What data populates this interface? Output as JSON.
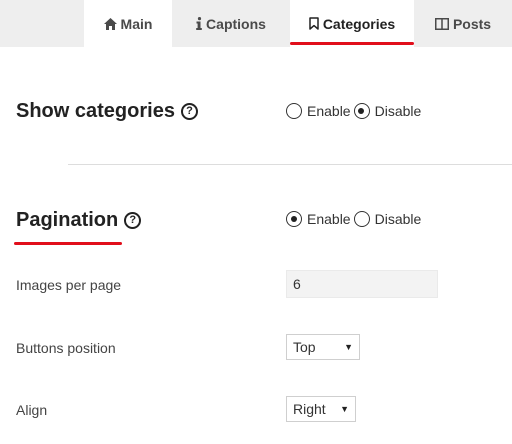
{
  "tabs": [
    {
      "label": "Main",
      "icon": "home-icon"
    },
    {
      "label": "Captions",
      "icon": "info-icon"
    },
    {
      "label": "Categories",
      "icon": "bookmark-icon"
    },
    {
      "label": "Posts",
      "icon": "columns-icon"
    }
  ],
  "active_tab": "Categories",
  "accent_color": "#e10e1b",
  "show_categories": {
    "title": "Show categories",
    "help": "?",
    "options": [
      "Enable",
      "Disable"
    ],
    "selected": "Disable"
  },
  "pagination": {
    "title": "Pagination",
    "help": "?",
    "options": [
      "Enable",
      "Disable"
    ],
    "selected": "Enable",
    "images_per_page": {
      "label": "Images per page",
      "value": "6"
    },
    "buttons_position": {
      "label": "Buttons position",
      "value": "Top"
    },
    "align": {
      "label": "Align",
      "value": "Right"
    }
  }
}
